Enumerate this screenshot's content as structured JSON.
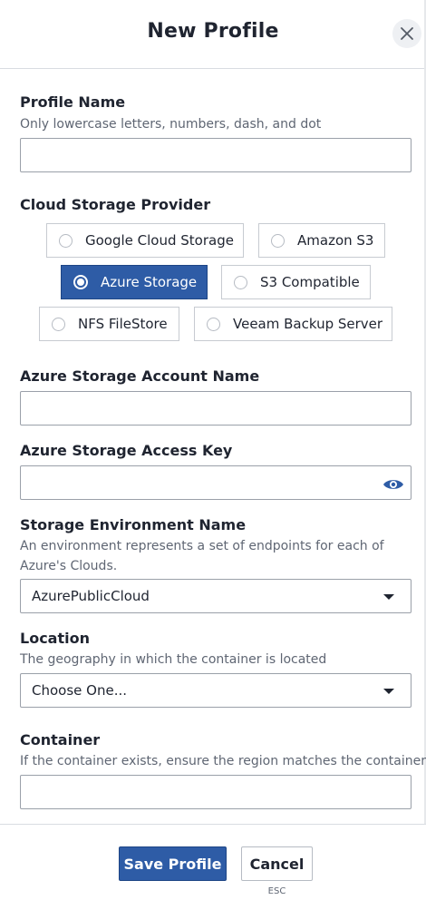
{
  "header": {
    "title": "New Profile"
  },
  "profile_name": {
    "label": "Profile Name",
    "help": "Only lowercase letters, numbers, dash, and dot",
    "value": ""
  },
  "provider": {
    "label": "Cloud Storage Provider",
    "options": [
      {
        "label": "Google Cloud Storage",
        "selected": false
      },
      {
        "label": "Amazon S3",
        "selected": false
      },
      {
        "label": "Azure Storage",
        "selected": true
      },
      {
        "label": "S3 Compatible",
        "selected": false
      },
      {
        "label": "NFS FileStore",
        "selected": false
      },
      {
        "label": "Veeam Backup Server",
        "selected": false
      }
    ]
  },
  "account_name": {
    "label": "Azure Storage Account Name",
    "value": ""
  },
  "access_key": {
    "label": "Azure Storage Access Key",
    "value": "",
    "visibility_icon": "eye-icon"
  },
  "environment": {
    "label": "Storage Environment Name",
    "help": "An environment represents a set of endpoints for each of Azure's Clouds.",
    "selected": "AzurePublicCloud"
  },
  "location": {
    "label": "Location",
    "help": "The geography in which the container is located",
    "selected": "Choose One..."
  },
  "container": {
    "label": "Container",
    "help": "If the container exists, ensure the region matches the container.",
    "value": ""
  },
  "footer": {
    "save_label": "Save Profile",
    "cancel_label": "Cancel",
    "cancel_hint": "ESC"
  },
  "colors": {
    "accent": "#2e5ca6",
    "text": "#1f2430",
    "muted": "#5f6673",
    "border": "#9aa0a9"
  }
}
